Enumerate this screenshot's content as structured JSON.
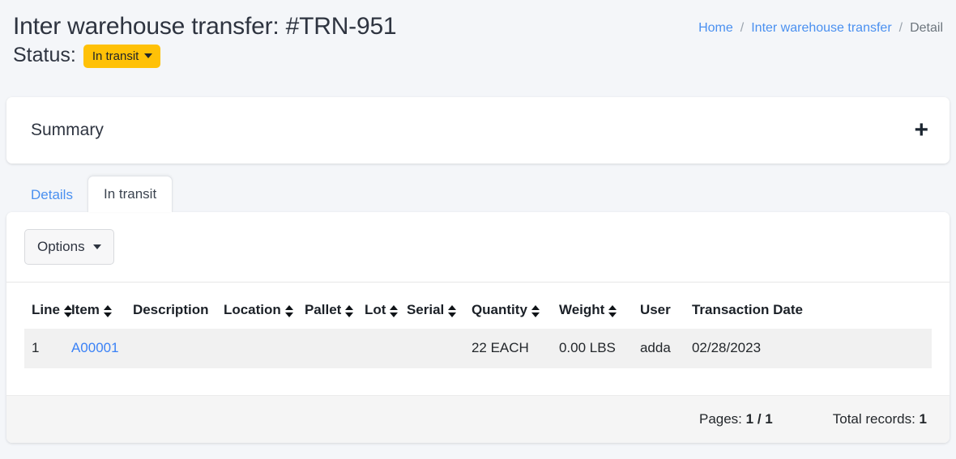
{
  "header": {
    "title": "Inter warehouse transfer: #TRN-951",
    "status_label": "Status:",
    "status_value": "In transit",
    "status_color": "#ffc107"
  },
  "breadcrumb": {
    "items": [
      {
        "label": "Home",
        "link": true
      },
      {
        "label": "Inter warehouse transfer",
        "link": true
      },
      {
        "label": "Detail",
        "link": false
      }
    ],
    "separator": "/"
  },
  "summary": {
    "title": "Summary",
    "expand_icon": "plus-icon",
    "expand_glyph": "+"
  },
  "tabs": [
    {
      "label": "Details",
      "active": false
    },
    {
      "label": "In transit",
      "active": true
    }
  ],
  "toolbar": {
    "options_label": "Options"
  },
  "table": {
    "columns": [
      {
        "label": "Line",
        "sortable": true
      },
      {
        "label": "Item",
        "sortable": true
      },
      {
        "label": "Description",
        "sortable": false
      },
      {
        "label": "Location",
        "sortable": true
      },
      {
        "label": "Pallet",
        "sortable": true
      },
      {
        "label": "Lot",
        "sortable": true
      },
      {
        "label": "Serial",
        "sortable": true
      },
      {
        "label": "Quantity",
        "sortable": true
      },
      {
        "label": "Weight",
        "sortable": true
      },
      {
        "label": "User",
        "sortable": false
      },
      {
        "label": "Transaction Date",
        "sortable": false
      }
    ],
    "rows": [
      {
        "line": "1",
        "item": "A00001",
        "description": "",
        "location": "",
        "pallet": "",
        "lot": "",
        "serial": "",
        "quantity": "22 EACH",
        "weight": "0.00 LBS",
        "user": "adda",
        "transaction_date": "02/28/2023"
      }
    ]
  },
  "footer": {
    "pages_label": "Pages:",
    "pages_value": "1 / 1",
    "total_label": "Total records:",
    "total_value": "1"
  }
}
